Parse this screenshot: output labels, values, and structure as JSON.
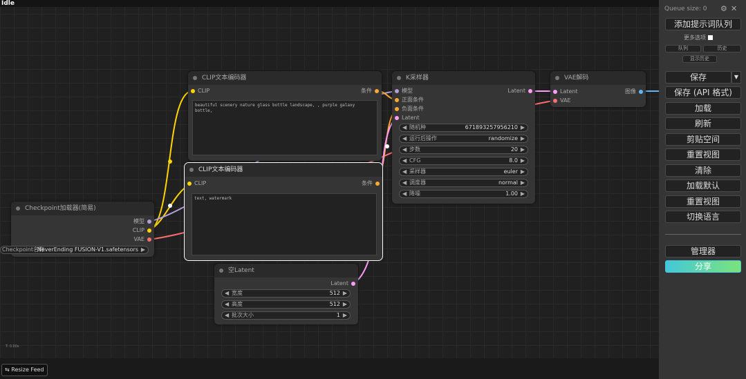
{
  "status": "Idle",
  "panel": {
    "queue_size": "Queue size: 0",
    "queue_prompt": "添加提示词队列",
    "extra_options": "更多选项",
    "view_queue": "队列",
    "view_history": "历史",
    "show_history": "显示历史",
    "save": "保存",
    "save_api": "保存 (API 格式)",
    "load": "加载",
    "refresh": "刷新",
    "clipspace": "剪贴空间",
    "reset_view": "重置视图",
    "clear": "清除",
    "load_default": "加载默认",
    "reset_view2": "重置视图",
    "switch_lang": "切换语言",
    "manager": "管理器",
    "share": "分享",
    "share_color": "#43c8d9"
  },
  "nodes": {
    "clip1": {
      "title": "CLIP文本编码器",
      "input": "CLIP",
      "output": "条件",
      "text": "beautiful scenery nature glass bottle landscape, , purple galaxy bottle,"
    },
    "clip2": {
      "title": "CLIP文本编码器",
      "input": "CLIP",
      "output": "条件",
      "text": "text, watermark"
    },
    "ksampler": {
      "title": "K采样器",
      "inputs": [
        "模型",
        "正面条件",
        "负面条件",
        "Latent"
      ],
      "output": "Latent",
      "widgets": [
        {
          "label": "随机种",
          "value": "671893257956210"
        },
        {
          "label": "运行后操作",
          "value": "randomize"
        },
        {
          "label": "步数",
          "value": "20"
        },
        {
          "label": "CFG",
          "value": "8.0"
        },
        {
          "label": "采样器",
          "value": "euler"
        },
        {
          "label": "调度器",
          "value": "normal"
        },
        {
          "label": "降噪",
          "value": "1.00"
        }
      ]
    },
    "vae": {
      "title": "VAE解码",
      "inputs": [
        "Latent",
        "VAE"
      ],
      "output": "图像"
    },
    "checkpoint": {
      "title": "Checkpoint加载器(简易)",
      "outputs": [
        "模型",
        "CLIP",
        "VAE"
      ],
      "widget_label": "Checkpoint名称",
      "widget_value": "NeverEnding FUSION-V1.safetensors"
    },
    "latent": {
      "title": "空Latent",
      "output": "Latent",
      "widgets": [
        {
          "label": "宽度",
          "value": "512"
        },
        {
          "label": "高度",
          "value": "512"
        },
        {
          "label": "批次大小",
          "value": "1"
        }
      ]
    }
  },
  "footer": {
    "resize": "⇆ Resize Feed",
    "stats": "T: 0.00s"
  },
  "colors": {
    "clip": "#ffd500",
    "conditioning": "#ffa931",
    "model": "#b39ddb",
    "latent": "#ff9cf9",
    "vae": "#ff6e6e",
    "image": "#64b5f6"
  }
}
